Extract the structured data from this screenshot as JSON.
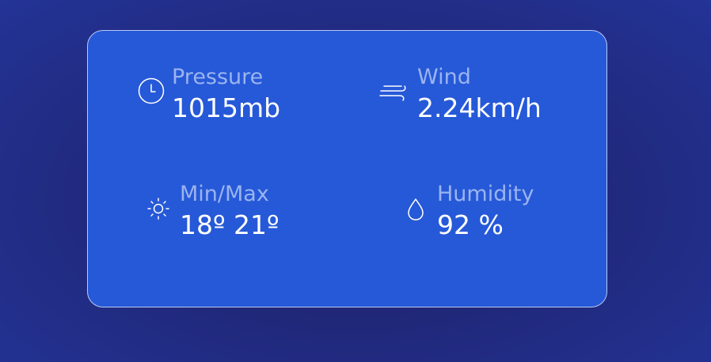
{
  "weather_details": {
    "pressure": {
      "icon": "clock-icon",
      "label": "Pressure",
      "value": "1015mb"
    },
    "wind": {
      "icon": "wind-icon",
      "label": "Wind",
      "value": "2.24km/h"
    },
    "min_max": {
      "icon": "sun-icon",
      "label": "Min/Max",
      "value": "18º 21º"
    },
    "humidity": {
      "icon": "droplet-icon",
      "label": "Humidity",
      "value": "92 %"
    }
  },
  "colors": {
    "card_background": "#2659d8",
    "label_text": "#9bb4ef",
    "value_text": "#ffffff",
    "page_background": "#20287a"
  }
}
